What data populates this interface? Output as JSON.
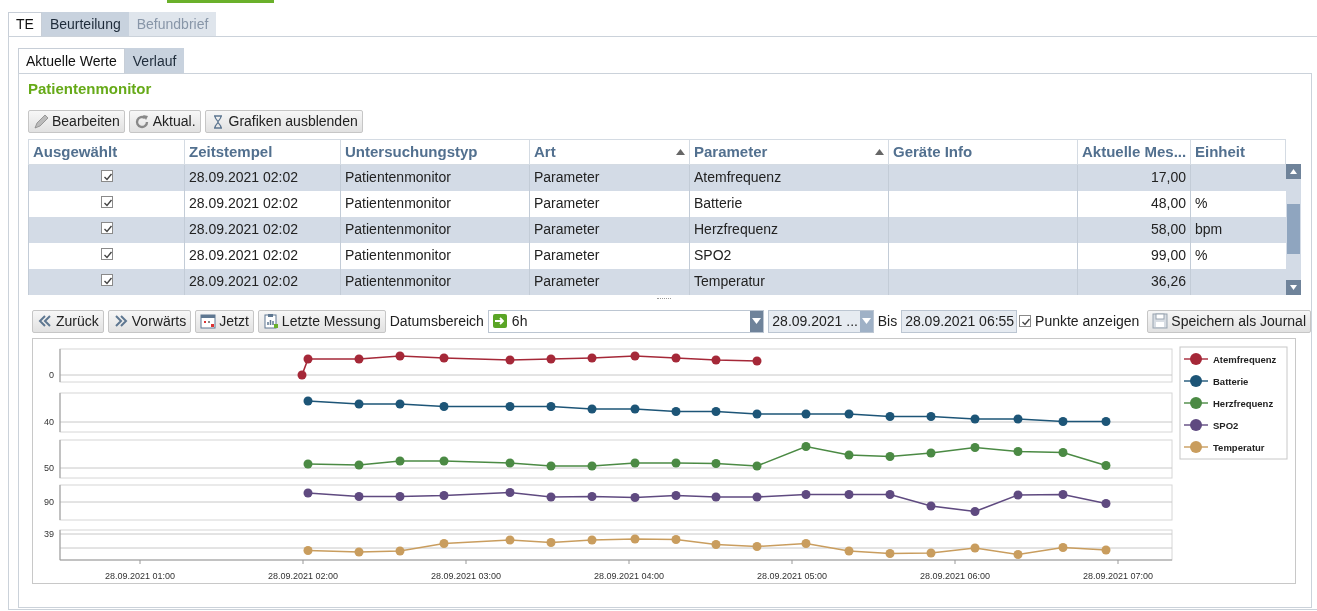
{
  "outer_tabs": [
    {
      "label": "TE",
      "selected": true,
      "disabled": false
    },
    {
      "label": "Beurteilung",
      "selected": false,
      "disabled": false
    },
    {
      "label": "Befundbrief",
      "selected": false,
      "disabled": true
    }
  ],
  "inner_tabs": [
    {
      "label": "Aktuelle Werte",
      "selected": true
    },
    {
      "label": "Verlauf",
      "selected": false
    }
  ],
  "section_title": "Patientenmonitor",
  "toolbar": [
    "Bearbeiten",
    "Aktual.",
    "Grafiken ausblenden"
  ],
  "table": {
    "columns": [
      {
        "label": "Ausgewählt",
        "sorted": false
      },
      {
        "label": "Zeitstempel",
        "sorted": false
      },
      {
        "label": "Untersuchungstyp",
        "sorted": false
      },
      {
        "label": "Art",
        "sorted": true
      },
      {
        "label": "Parameter",
        "sorted": true
      },
      {
        "label": "Geräte Info",
        "sorted": false
      },
      {
        "label": "Aktuelle Mes...",
        "sorted": false
      },
      {
        "label": "Einheit",
        "sorted": false
      }
    ],
    "rows": [
      {
        "checked": true,
        "zeitstempel": "28.09.2021 02:02",
        "untersuchungstyp": "Patientenmonitor",
        "art": "Parameter",
        "parameter": "Atemfrequenz",
        "messung": "17,00"
      },
      {
        "checked": true,
        "zeitstempel": "28.09.2021 02:02",
        "untersuchungstyp": "Patientenmonitor",
        "art": "Parameter",
        "parameter": "Batterie",
        "messung": "48,00",
        "einheit": "%"
      },
      {
        "checked": true,
        "zeitstempel": "28.09.2021 02:02",
        "untersuchungstyp": "Patientenmonitor",
        "art": "Parameter",
        "parameter": "Herzfrequenz",
        "messung": "58,00",
        "einheit": "bpm"
      },
      {
        "checked": true,
        "zeitstempel": "28.09.2021 02:02",
        "untersuchungstyp": "Patientenmonitor",
        "art": "Parameter",
        "parameter": "SPO2",
        "messung": "99,00",
        "einheit": "%"
      },
      {
        "checked": true,
        "zeitstempel": "28.09.2021 02:02",
        "untersuchungstyp": "Patientenmonitor",
        "art": "Parameter",
        "parameter": "Temperatur",
        "messung": "36,26"
      }
    ]
  },
  "history_toolbar": {
    "buttons": [
      "Zurück",
      "Vorwärts",
      "Jetzt",
      "Letzte Messung"
    ],
    "range_label": "Datumsbereich",
    "range_value": "6h",
    "from_value": "28.09.2021 ...",
    "to_label": "Bis",
    "to_value": "28.09.2021 06:55",
    "show_points": {
      "label": "Punkte anzeigen",
      "checked": true
    },
    "save_button": "Speichern als Journal"
  },
  "chart": {
    "pane_ticks": [
      "0",
      "40",
      "50",
      "90",
      "39"
    ],
    "x_labels": [
      "28.09.2021 01:00",
      "28.09.2021 02:00",
      "28.09.2021 03:00",
      "28.09.2021 04:00",
      "28.09.2021 05:00",
      "28.09.2021 06:00",
      "28.09.2021 07:00"
    ],
    "legend": [
      {
        "label": "Atemfrequenz",
        "color": "#a52838"
      },
      {
        "label": "Batterie",
        "color": "#1d5577"
      },
      {
        "label": "Herzfrequenz",
        "color": "#4b8a44"
      },
      {
        "label": "SPO2",
        "color": "#5f4a80"
      },
      {
        "label": "Temperatur",
        "color": "#c99d5e"
      }
    ]
  }
}
